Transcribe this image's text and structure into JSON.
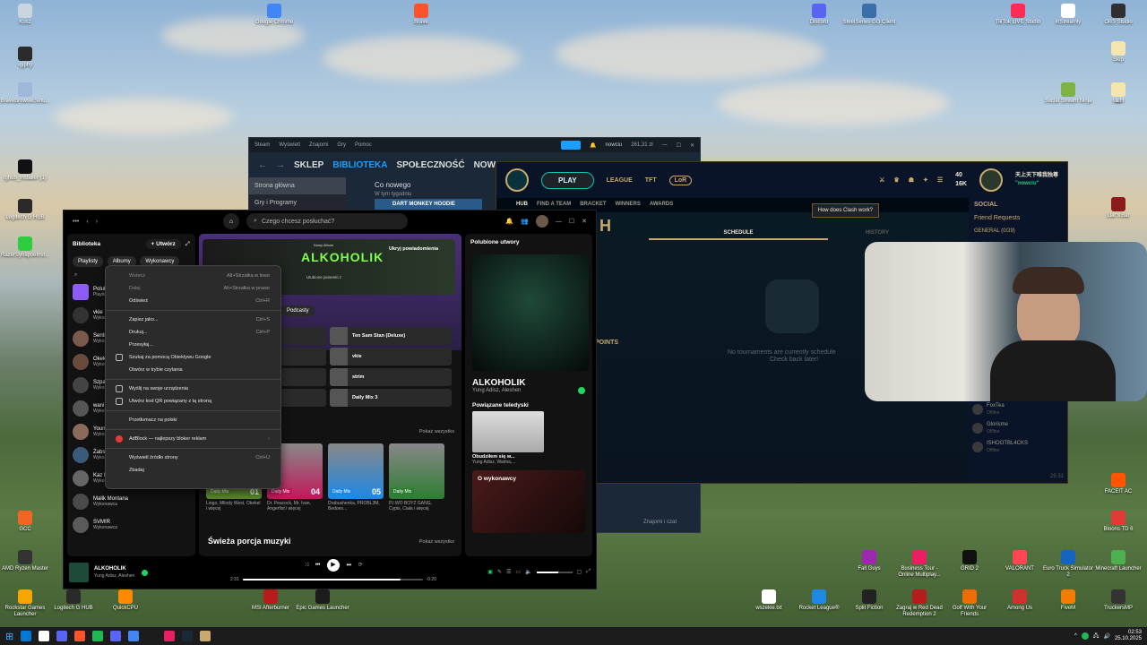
{
  "desktop": {
    "left_icons": [
      {
        "label": "Kosz",
        "color": "#c9d4df"
      },
      {
        "label": "-giphy",
        "color": "#2b2b2b"
      },
      {
        "label": "BraveBrowserSetu...",
        "color": "#9db8d9"
      },
      {
        "label": "lghub_installer (1)",
        "color": "#111111"
      },
      {
        "label": "Logitech G HUB",
        "color": "#2a2a2a"
      },
      {
        "label": "RazerSynapseInst...",
        "color": "#2ecc40"
      },
      {
        "label": "GCC",
        "color": "#f26522"
      },
      {
        "label": "AMD Ryzen Master",
        "color": "#333333"
      },
      {
        "label": "Rockstar Games Launcher",
        "color": "#f7a600"
      }
    ],
    "top_icons": [
      {
        "label": "Google Chrome",
        "color": "#4285f4"
      },
      {
        "label": "Brave",
        "color": "#fb542b"
      },
      {
        "label": "Discord",
        "color": "#5865f2"
      },
      {
        "label": "SteelSeries GG Client",
        "color": "#3c6fa8"
      },
      {
        "label": "TikTok LIVE Studio",
        "color": "#fe2c55"
      },
      {
        "label": "irlStreamly",
        "color": "#ffffff"
      },
      {
        "label": "OBS Studio",
        "color": "#302e31"
      }
    ],
    "right_icons": [
      {
        "label": "Skip",
        "color": "#f5e6b0"
      },
      {
        "label": "strim",
        "color": "#f5e6b0"
      },
      {
        "label": "Social Stream Ninja",
        "color": "#7cb342"
      },
      {
        "label": "all",
        "color": "#f5e6b0"
      },
      {
        "label": "Liar's Bar",
        "color": "#8b1a1a"
      },
      {
        "label": "FACEIT AC",
        "color": "#ff5500"
      },
      {
        "label": "Bloons TD 6",
        "color": "#e53935"
      },
      {
        "label": "Minecraft Launcher",
        "color": "#4caf50"
      },
      {
        "label": "TruckersMP",
        "color": "#333333"
      }
    ],
    "bottom_icons": [
      {
        "label": "Logitech G HUB",
        "color": "#2a2a2a"
      },
      {
        "label": "QuickCPU",
        "color": "#ff8a00"
      },
      {
        "label": "MSI Afterburner",
        "color": "#b71c1c"
      },
      {
        "label": "Epic Games Launcher",
        "color": "#1c1c1c"
      },
      {
        "label": "wszekie.txt",
        "color": "#ffffff"
      },
      {
        "label": "Rocket League®",
        "color": "#1e88e5"
      },
      {
        "label": "Split Fiction",
        "color": "#222222"
      },
      {
        "label": "Zagraj w Red Dead Redemption 2",
        "color": "#b71c1c"
      },
      {
        "label": "Golf With Your Friends",
        "color": "#ef6c00"
      },
      {
        "label": "Among Us",
        "color": "#d32f2f"
      },
      {
        "label": "FiveM",
        "color": "#f57c00"
      },
      {
        "label": "Euro Truck Simulator 2",
        "color": "#1565c0"
      },
      {
        "label": "Fall Guys",
        "color": "#9c27b0"
      },
      {
        "label": "Business Tour - Online Multiplay...",
        "color": "#e91e63"
      },
      {
        "label": "GRID 2",
        "color": "#111111"
      },
      {
        "label": "VALORANT",
        "color": "#ff4655"
      }
    ]
  },
  "steam": {
    "topbar": [
      "Steam",
      "Wyświetl",
      "Znajomi",
      "Gry",
      "Pomoc"
    ],
    "nav": [
      "SKLEP",
      "BIBLIOTEKA",
      "SPOŁECZNOŚĆ",
      "NOWCIU"
    ],
    "active_nav": "BIBLIOTEKA",
    "user": "nowciu",
    "balance": "261,31 zł",
    "side": [
      "Strona główna",
      "Gry i Programy"
    ],
    "whats_new": "Co nowego",
    "this_week": "W tym tygodniu",
    "banner": "DART MONKEY HOODIE",
    "friends_chat": "Znajomi i czat"
  },
  "league": {
    "play": "PLAY",
    "nav": [
      "LEAGUE",
      "TFT",
      "LoR"
    ],
    "sub": [
      "HUB",
      "FIND A TEAM",
      "BRACKET",
      "WINNERS",
      "AWARDS"
    ],
    "currency_a": "40",
    "currency_b": "16K",
    "clash_help": "How does Clash work?",
    "tabs": [
      "SCHEDULE",
      "HISTORY"
    ],
    "empty_1": "No tournaments are currently schedule",
    "empty_2": "Check back later!",
    "points": "POINTS",
    "username": "天上天下唯我独尊",
    "status": "\"nowciu\"",
    "social": "SOCIAL",
    "friend_requests": "Friend Requests",
    "general": "GENERAL (0/29)",
    "friends": [
      {
        "name": "FoxTea",
        "status": "Offline"
      },
      {
        "name": "Glorisme",
        "status": "Offline"
      },
      {
        "name": "ISHOOTBL4CKS",
        "status": "Offline"
      }
    ],
    "time": "25:31"
  },
  "spotify": {
    "search_placeholder": "Czego chcesz posłuchać?",
    "library_title": "Biblioteka",
    "create": "Utwórz",
    "chips": [
      "Playlisty",
      "Albumy",
      "Wykonawcy"
    ],
    "library_items": [
      {
        "title": "Polubione utwory",
        "sub": "Playlista",
        "color": "#8d5cf6"
      },
      {
        "title": "vkie",
        "sub": "Wykonawca",
        "color": "#333333"
      },
      {
        "title": "Sentino",
        "sub": "Wykonawca",
        "color": "#7a5a4a"
      },
      {
        "title": "Okekel",
        "sub": "Wykonawca",
        "color": "#6a4a3a"
      },
      {
        "title": "Szpaku",
        "sub": "Wykonawca",
        "color": "#444444"
      },
      {
        "title": "wani",
        "sub": "Wykonawca",
        "color": "#555555"
      },
      {
        "title": "Young Leosia",
        "sub": "Wykonawca",
        "color": "#8a6a5a"
      },
      {
        "title": "Żabson",
        "sub": "Wykonawca",
        "color": "#3a5a7a"
      },
      {
        "title": "Kaz Bałagane",
        "sub": "Wykonawca",
        "color": "#666666"
      },
      {
        "title": "Malik Montana",
        "sub": "Wykonawca",
        "color": "#4a4a4a"
      },
      {
        "title": "SVM!R",
        "sub": "Wykonawca",
        "color": "#5a5a5a"
      }
    ],
    "banner_small": "Nowy Album",
    "banner_title": "ALKOHOLIK",
    "banner_sub": "Ulubione piosenki z",
    "banner_label": "Ukryj powiadomienia",
    "podcasts_chip": "Podcasty",
    "shortcuts": [
      "Ten Sam Stan (Deluxe)",
      "vkie",
      "strim",
      "Daily Mix 3"
    ],
    "shortcuts_left": [
      "",
      "",
      "liska",
      ""
    ],
    "show_all": "Pokaż wszystko",
    "mixes": [
      {
        "label": "Daily Mix",
        "num": "01",
        "desc": "Lingo, Milody West, Okekel i więcej",
        "color": "#5a8a2a"
      },
      {
        "label": "Daily Mix",
        "num": "04",
        "desc": "Dr. Peacock, Mr. Ivan, Angerfist i więcej",
        "color": "#c2185b"
      },
      {
        "label": "Daily Mix",
        "num": "05",
        "desc": "Drabushenka, PROBL3M, Bedoes...",
        "color": "#1e88e5"
      },
      {
        "label": "Daily Mix",
        "num": "",
        "desc": "P.I.WO BOYZ GANG, Cypis, Ciała i więcej",
        "color": "#2e7d32"
      }
    ],
    "fresh_title": "Świeża porcja muzyki",
    "show_all_2": "Pokaż wszystko",
    "right_header": "Polubione utwory",
    "now_title": "ALKOHOLIK",
    "now_artist": "Yung Adisz, Aleshen",
    "related_videos": "Powiązane teledyski",
    "video_title": "Obudziłem się w...",
    "video_artist": "Yung Adisz, Waima,...",
    "about_artist": "O wykonawcy",
    "player_title": "ALKOHOLIK",
    "player_artist": "Yung Adisz, Aleshen",
    "time_current": "2:31",
    "time_total": "-0:20",
    "progress": 0.88,
    "volume": 0.6
  },
  "context_menu": {
    "items": [
      {
        "label": "Wstecz",
        "shortcut": "Alt+Strzałka w lewo",
        "disabled": true
      },
      {
        "label": "Dalej",
        "shortcut": "Alt+Strzałka w prawo",
        "disabled": true
      },
      {
        "label": "Odśwież",
        "shortcut": "Ctrl+R",
        "disabled": false
      },
      {
        "sep": true
      },
      {
        "label": "Zapisz jako...",
        "shortcut": "Ctrl+S",
        "disabled": false
      },
      {
        "label": "Drukuj...",
        "shortcut": "Ctrl+P",
        "disabled": false
      },
      {
        "label": "Przesyłaj...",
        "shortcut": "",
        "disabled": false
      },
      {
        "label": "Szukaj za pomocą Obiektywu Google",
        "shortcut": "",
        "disabled": false,
        "icon": "lens-icon"
      },
      {
        "label": "Otwórz w trybie czytania",
        "shortcut": "",
        "disabled": false
      },
      {
        "sep": true
      },
      {
        "label": "Wyślij na swoje urządzenia",
        "shortcut": "",
        "disabled": false,
        "icon": "devices-icon"
      },
      {
        "label": "Utwórz kod QR powiązany z tą stroną",
        "shortcut": "",
        "disabled": false,
        "icon": "qr-icon"
      },
      {
        "sep": true
      },
      {
        "label": "Przetłumacz na polski",
        "shortcut": "",
        "disabled": false
      },
      {
        "sep": true
      },
      {
        "label": "AdBlock — najlepszy bloker reklam",
        "shortcut": "›",
        "disabled": false,
        "icon": "adblock-icon"
      },
      {
        "sep": true
      },
      {
        "label": "Wyświetl źródło strony",
        "shortcut": "Ctrl+U",
        "disabled": false
      },
      {
        "label": "Zbadaj",
        "shortcut": "",
        "disabled": false
      }
    ]
  },
  "taskbar": {
    "time": "02:53",
    "date": "25.10.2025",
    "apps": [
      "#0078d4",
      "#ffffff",
      "#5865f2",
      "#fb542b",
      "#1db954",
      "#5865f2",
      "#4285f4",
      "#1c1c1c",
      "#e91e63",
      "#1b2838",
      "#c8aa6e"
    ]
  }
}
